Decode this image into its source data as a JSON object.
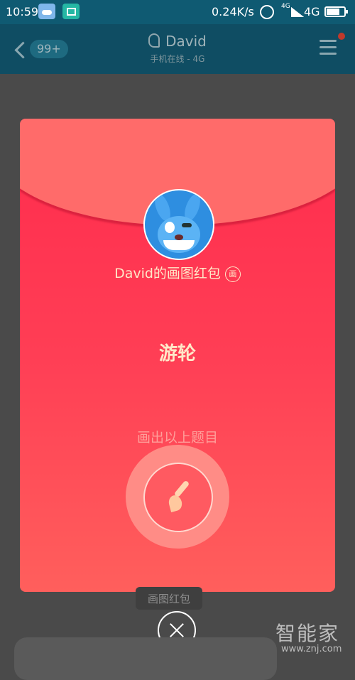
{
  "status_bar": {
    "time": "10:59",
    "speed": "0.24K/s",
    "network_small": "4G",
    "network": "4G"
  },
  "chat_header": {
    "unread_count": "99+",
    "contact_name": "David",
    "contact_status": "手机在线 - 4G"
  },
  "red_packet": {
    "title": "David的画图红包",
    "badge": "画",
    "topic": "游轮",
    "hint": "画出以上题目"
  },
  "background": {
    "packet_label": "画图红包"
  },
  "watermark": {
    "text": "智能家",
    "url": "www.znj.com"
  },
  "colors": {
    "packet_top": "#ff2b4d",
    "packet_bottom": "#ff5f5c",
    "text_gold": "#ffe8c8"
  },
  "icons": {
    "weather": "weather-icon",
    "scan": "scan-icon",
    "hotspot": "hotspot-icon",
    "signal": "signal-icon",
    "battery": "battery-icon",
    "back": "back-chevron-icon",
    "ear": "ear-icon",
    "menu": "menu-icon",
    "brush": "brush-icon",
    "close": "close-icon"
  }
}
